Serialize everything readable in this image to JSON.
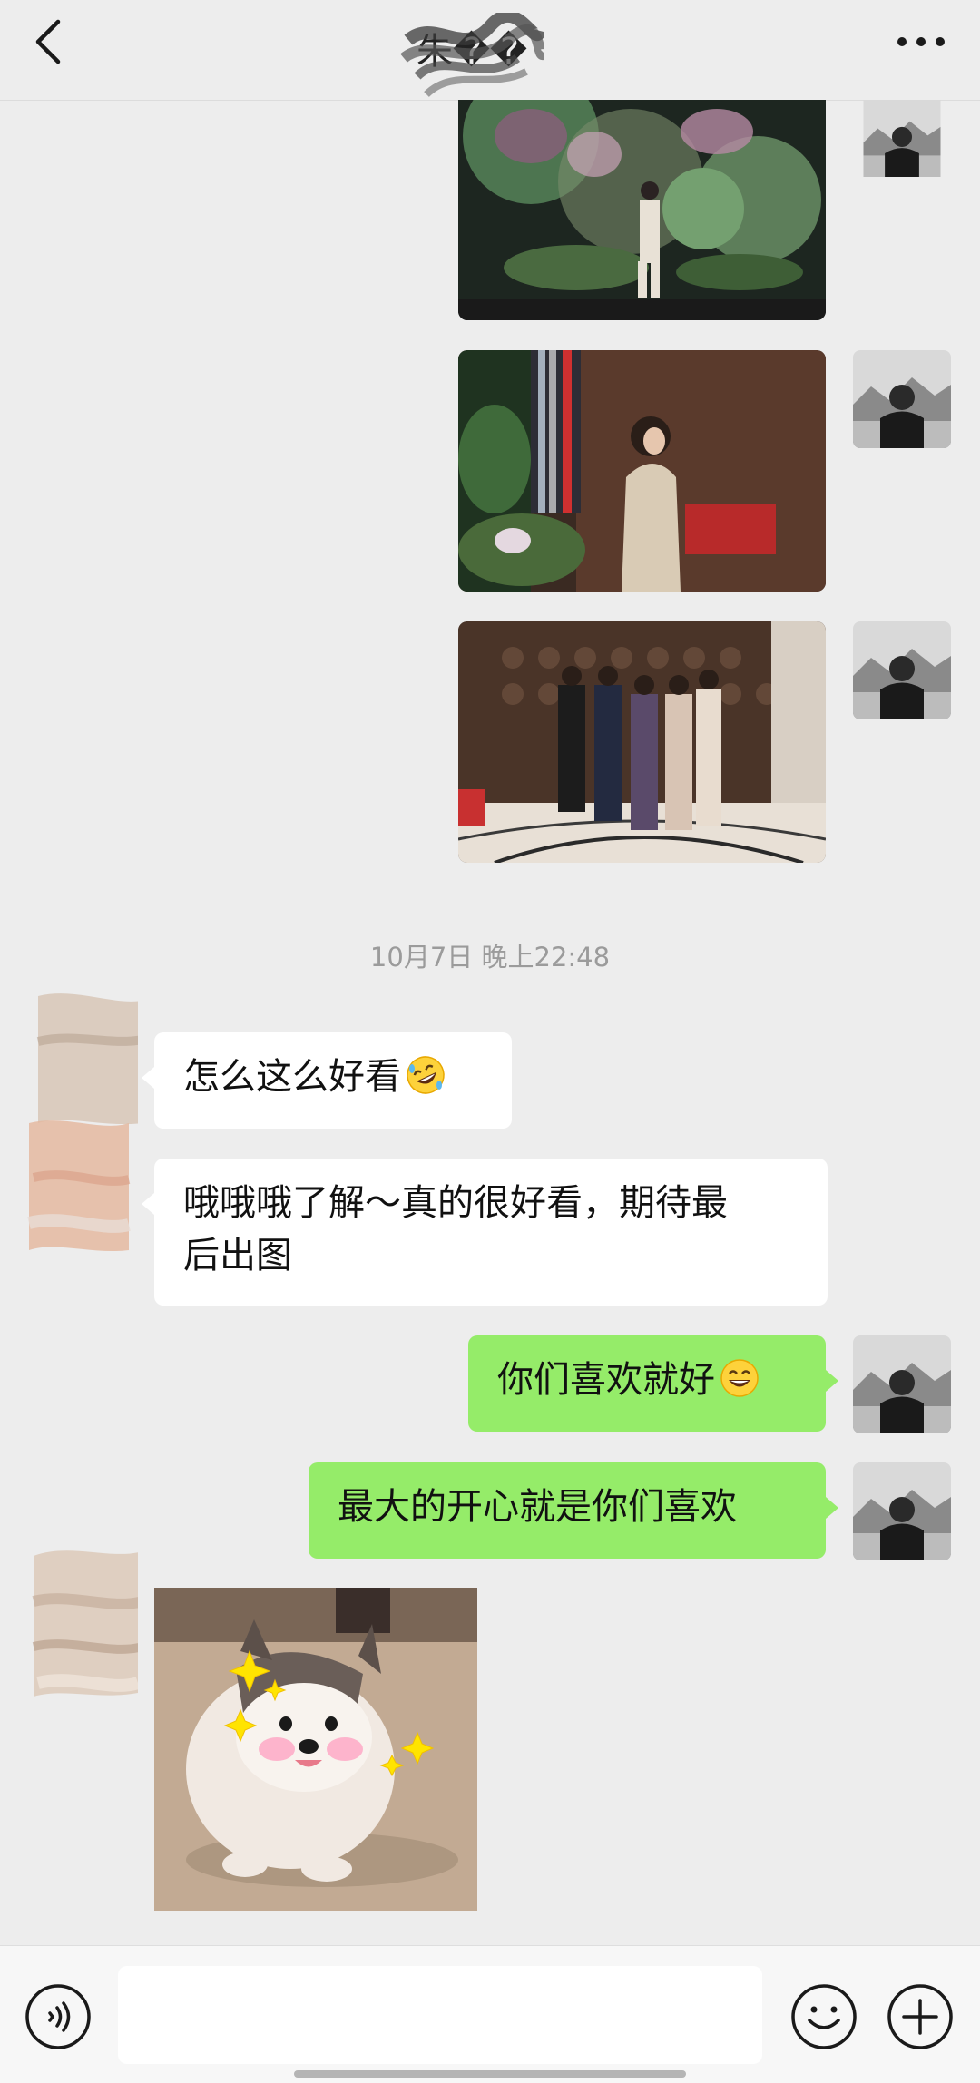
{
  "header": {
    "back_icon": "chevron-left-icon",
    "title": "朱��",
    "more_icon": "ellipsis-icon"
  },
  "messages": {
    "timestamp": "10月7日 晚上22:48",
    "left_1": "怎么这么好看",
    "left_2_line1": "哦哦哦了解～真的很好看，期待最",
    "left_2_line2": "后出图",
    "right_1": "你们喜欢就好",
    "right_2": "最大的开心就是你们喜欢"
  },
  "emojis": {
    "left_1": "rolling-laughing-emoji",
    "right_1": "grinning-emoji"
  },
  "input_bar": {
    "voice_icon": "voice-icon",
    "input_value": "",
    "emoji_icon": "smiley-icon",
    "plus_icon": "plus-icon"
  },
  "colors": {
    "background": "#ededed",
    "bubble_self": "#95ec69",
    "bubble_other": "#ffffff",
    "timestamp": "#9b9b9b"
  }
}
